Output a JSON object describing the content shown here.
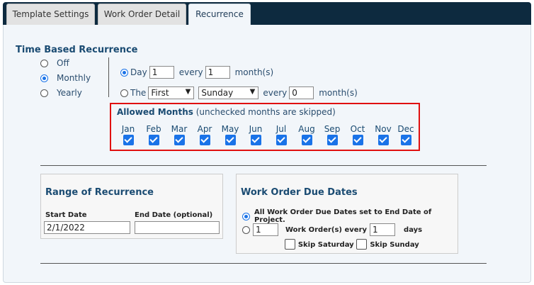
{
  "tabs": [
    {
      "label": "Template Settings",
      "active": false
    },
    {
      "label": "Work Order Detail",
      "active": false
    },
    {
      "label": "Recurrence",
      "active": true
    }
  ],
  "time_based": {
    "title": "Time Based Recurrence",
    "options": [
      {
        "label": "Off",
        "checked": false
      },
      {
        "label": "Monthly",
        "checked": true
      },
      {
        "label": "Yearly",
        "checked": false
      }
    ],
    "day_row": {
      "radio_checked": true,
      "day_label": "Day",
      "day_value": "1",
      "every_label": "every",
      "every_value": "1",
      "unit": "month(s)"
    },
    "the_row": {
      "radio_checked": false,
      "the_label": "The",
      "ordinal_selected": "First",
      "weekday_selected": "Sunday",
      "every_label": "every",
      "every_value": "0",
      "unit": "month(s)"
    }
  },
  "allowed_months": {
    "title": "Allowed Months",
    "note": "(unchecked months are skipped)",
    "months": [
      {
        "label": "Jan",
        "checked": true
      },
      {
        "label": "Feb",
        "checked": true
      },
      {
        "label": "Mar",
        "checked": true
      },
      {
        "label": "Apr",
        "checked": true
      },
      {
        "label": "May",
        "checked": true
      },
      {
        "label": "Jun",
        "checked": true
      },
      {
        "label": "Jul",
        "checked": true
      },
      {
        "label": "Aug",
        "checked": true
      },
      {
        "label": "Sep",
        "checked": true
      },
      {
        "label": "Oct",
        "checked": true
      },
      {
        "label": "Nov",
        "checked": true
      },
      {
        "label": "Dec",
        "checked": true
      }
    ]
  },
  "range": {
    "title": "Range of Recurrence",
    "start_label": "Start Date",
    "start_value": "2/1/2022",
    "end_label": "End Date (optional)",
    "end_value": ""
  },
  "due_dates": {
    "title": "Work Order Due Dates",
    "option_all": "All Work Order Due Dates set to End Date of Project.",
    "option_all_checked": true,
    "count_value": "1",
    "every_label": "Work Order(s) every",
    "every_value": "1",
    "days_label": "days",
    "skip_saturday": "Skip Saturday",
    "skip_sunday": "Skip Sunday"
  },
  "colors": {
    "header_bg": "#0d2a3f",
    "accent": "#1a73e8",
    "highlight": "#e01010"
  }
}
